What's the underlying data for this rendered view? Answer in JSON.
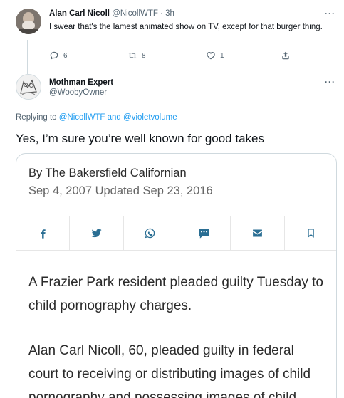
{
  "tweet1": {
    "name": "Alan Carl Nicoll",
    "handle": "@NicollWTF",
    "time": "3h",
    "separator": "·",
    "text": "I swear that's the lamest animated show on TV, except for that burger thing.",
    "replies": "6",
    "retweets": "8",
    "likes": "1",
    "more": "···"
  },
  "tweet2": {
    "name": "Mothman Expert",
    "handle": "@WoobyOwner",
    "more": "···",
    "replying_prefix": "Replying to ",
    "replying_user1": "@NicollWTF",
    "replying_and": " and ",
    "replying_user2": "@violetvolume",
    "text": "Yes, I’m sure you’re well known for good takes"
  },
  "card": {
    "byline": "By The Bakersfield Californian",
    "dateline": "Sep 4, 2007 Updated Sep 23, 2016",
    "share_icons": [
      "facebook-icon",
      "twitter-icon",
      "whatsapp-icon",
      "sms-icon",
      "email-icon",
      "bookmark-icon"
    ],
    "paragraph1": "A Frazier Park resident pleaded guilty Tuesday to child pornography charges.",
    "paragraph2": "Alan Carl Nicoll, 60, pleaded guilty in federal court to receiving or distributing images of child pornography and possessing images of child"
  },
  "colors": {
    "link": "#1d9bf0",
    "muted": "#536471",
    "share_icon": "#2a6e93",
    "border": "#cfd9de"
  }
}
